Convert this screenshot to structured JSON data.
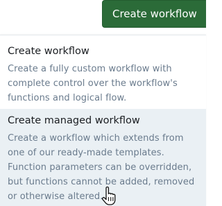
{
  "header": {
    "create_button_label": "Create workflow"
  },
  "dropdown": {
    "options": [
      {
        "title": "Create workflow",
        "description": "Create a fully custom workflow with complete control over the workflow's functions and logical flow."
      },
      {
        "title": "Create managed workflow",
        "description": "Create a workflow which extends from one of our ready-made templates. Function parameters can be overridden, but functions cannot be added, removed or otherwise altered."
      }
    ]
  },
  "colors": {
    "primary_button": "#2b6b38",
    "hover_background": "#eaf0f4",
    "title_text": "#1b1e22",
    "description_text": "#6a7b8d"
  },
  "icons": {
    "cursor": "hand-pointer-icon"
  }
}
